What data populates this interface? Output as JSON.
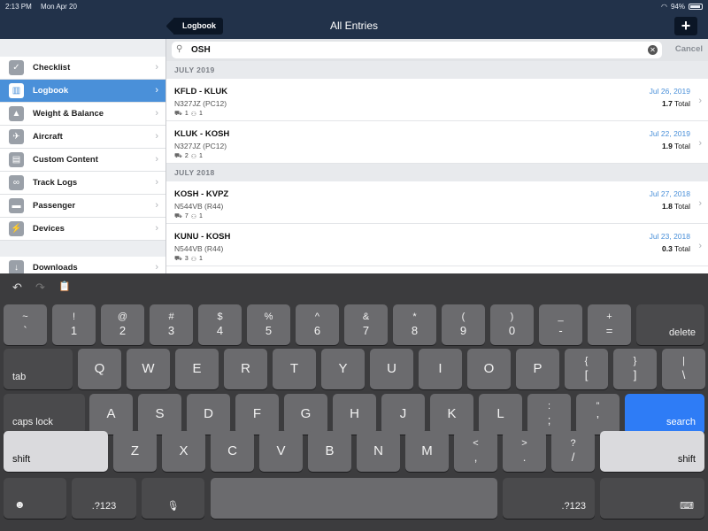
{
  "status_bar": {
    "time": "2:13 PM",
    "date": "Mon Apr 20",
    "battery": "94%"
  },
  "nav": {
    "back_label": "Logbook",
    "title": "All Entries",
    "add_label": "+"
  },
  "sidebar": {
    "items": [
      {
        "label": "Checklist",
        "icon": "checkmark-icon",
        "glyph": "✓"
      },
      {
        "label": "Logbook",
        "icon": "book-icon",
        "glyph": "▥"
      },
      {
        "label": "Weight & Balance",
        "icon": "weight-icon",
        "glyph": "▲"
      },
      {
        "label": "Aircraft",
        "icon": "airplane-icon",
        "glyph": "✈"
      },
      {
        "label": "Custom Content",
        "icon": "content-icon",
        "glyph": "▤"
      },
      {
        "label": "Track Logs",
        "icon": "track-icon",
        "glyph": "∞"
      },
      {
        "label": "Passenger",
        "icon": "passenger-icon",
        "glyph": "▬"
      },
      {
        "label": "Devices",
        "icon": "plug-icon",
        "glyph": "⚡"
      },
      {
        "label": "Downloads",
        "icon": "download-icon",
        "glyph": "↓"
      }
    ],
    "active_index": 1
  },
  "search": {
    "value": "OSH",
    "cancel_label": "Cancel"
  },
  "sections": [
    {
      "header": "JULY 2019",
      "entries": [
        {
          "route": "KFLD - KLUK",
          "aircraft": "N327JZ (PC12)",
          "pax": "1",
          "crew": "1",
          "date": "Jul 26, 2019",
          "total_value": "1.7",
          "total_label": "Total"
        },
        {
          "route": "KLUK - KOSH",
          "aircraft": "N327JZ (PC12)",
          "pax": "2",
          "crew": "1",
          "date": "Jul 22, 2019",
          "total_value": "1.9",
          "total_label": "Total"
        }
      ]
    },
    {
      "header": "JULY 2018",
      "entries": [
        {
          "route": "KOSH - KVPZ",
          "aircraft": "N544VB (R44)",
          "pax": "7",
          "crew": "1",
          "date": "Jul 27, 2018",
          "total_value": "1.8",
          "total_label": "Total"
        },
        {
          "route": "KUNU - KOSH",
          "aircraft": "N544VB (R44)",
          "pax": "3",
          "crew": "1",
          "date": "Jul 23, 2018",
          "total_value": "0.3",
          "total_label": "Total"
        }
      ]
    }
  ],
  "keyboard": {
    "toolbar": {
      "undo": "↶",
      "redo": "↷",
      "paste": "📋"
    },
    "number_row": [
      {
        "top": "~",
        "bot": "`"
      },
      {
        "top": "!",
        "bot": "1"
      },
      {
        "top": "@",
        "bot": "2"
      },
      {
        "top": "#",
        "bot": "3"
      },
      {
        "top": "$",
        "bot": "4"
      },
      {
        "top": "%",
        "bot": "5"
      },
      {
        "top": "^",
        "bot": "6"
      },
      {
        "top": "&",
        "bot": "7"
      },
      {
        "top": "*",
        "bot": "8"
      },
      {
        "top": "(",
        "bot": "9"
      },
      {
        "top": ")",
        "bot": "0"
      },
      {
        "top": "_",
        "bot": "-"
      },
      {
        "top": "+",
        "bot": "="
      }
    ],
    "delete_label": "delete",
    "tab_label": "tab",
    "row_q": [
      "Q",
      "W",
      "E",
      "R",
      "T",
      "Y",
      "U",
      "I",
      "O",
      "P"
    ],
    "row_q_extra": [
      {
        "top": "{",
        "bot": "["
      },
      {
        "top": "}",
        "bot": "]"
      },
      {
        "top": "|",
        "bot": "\\"
      }
    ],
    "caps_label": "caps lock",
    "row_a": [
      "A",
      "S",
      "D",
      "F",
      "G",
      "H",
      "J",
      "K",
      "L"
    ],
    "row_a_extra": [
      {
        "top": ":",
        "bot": ";"
      },
      {
        "top": "”",
        "bot": "’"
      }
    ],
    "search_label": "search",
    "shift_label": "shift",
    "row_z": [
      "Z",
      "X",
      "C",
      "V",
      "B",
      "N",
      "M"
    ],
    "row_z_extra": [
      {
        "top": "<",
        "bot": ","
      },
      {
        "top": ">",
        "bot": "."
      },
      {
        "top": "?",
        "bot": "/"
      }
    ],
    "emoji_glyph": "☻",
    "numbers_label": ".?123",
    "mic_glyph": "🎙",
    "hide_glyph": "⌨"
  }
}
